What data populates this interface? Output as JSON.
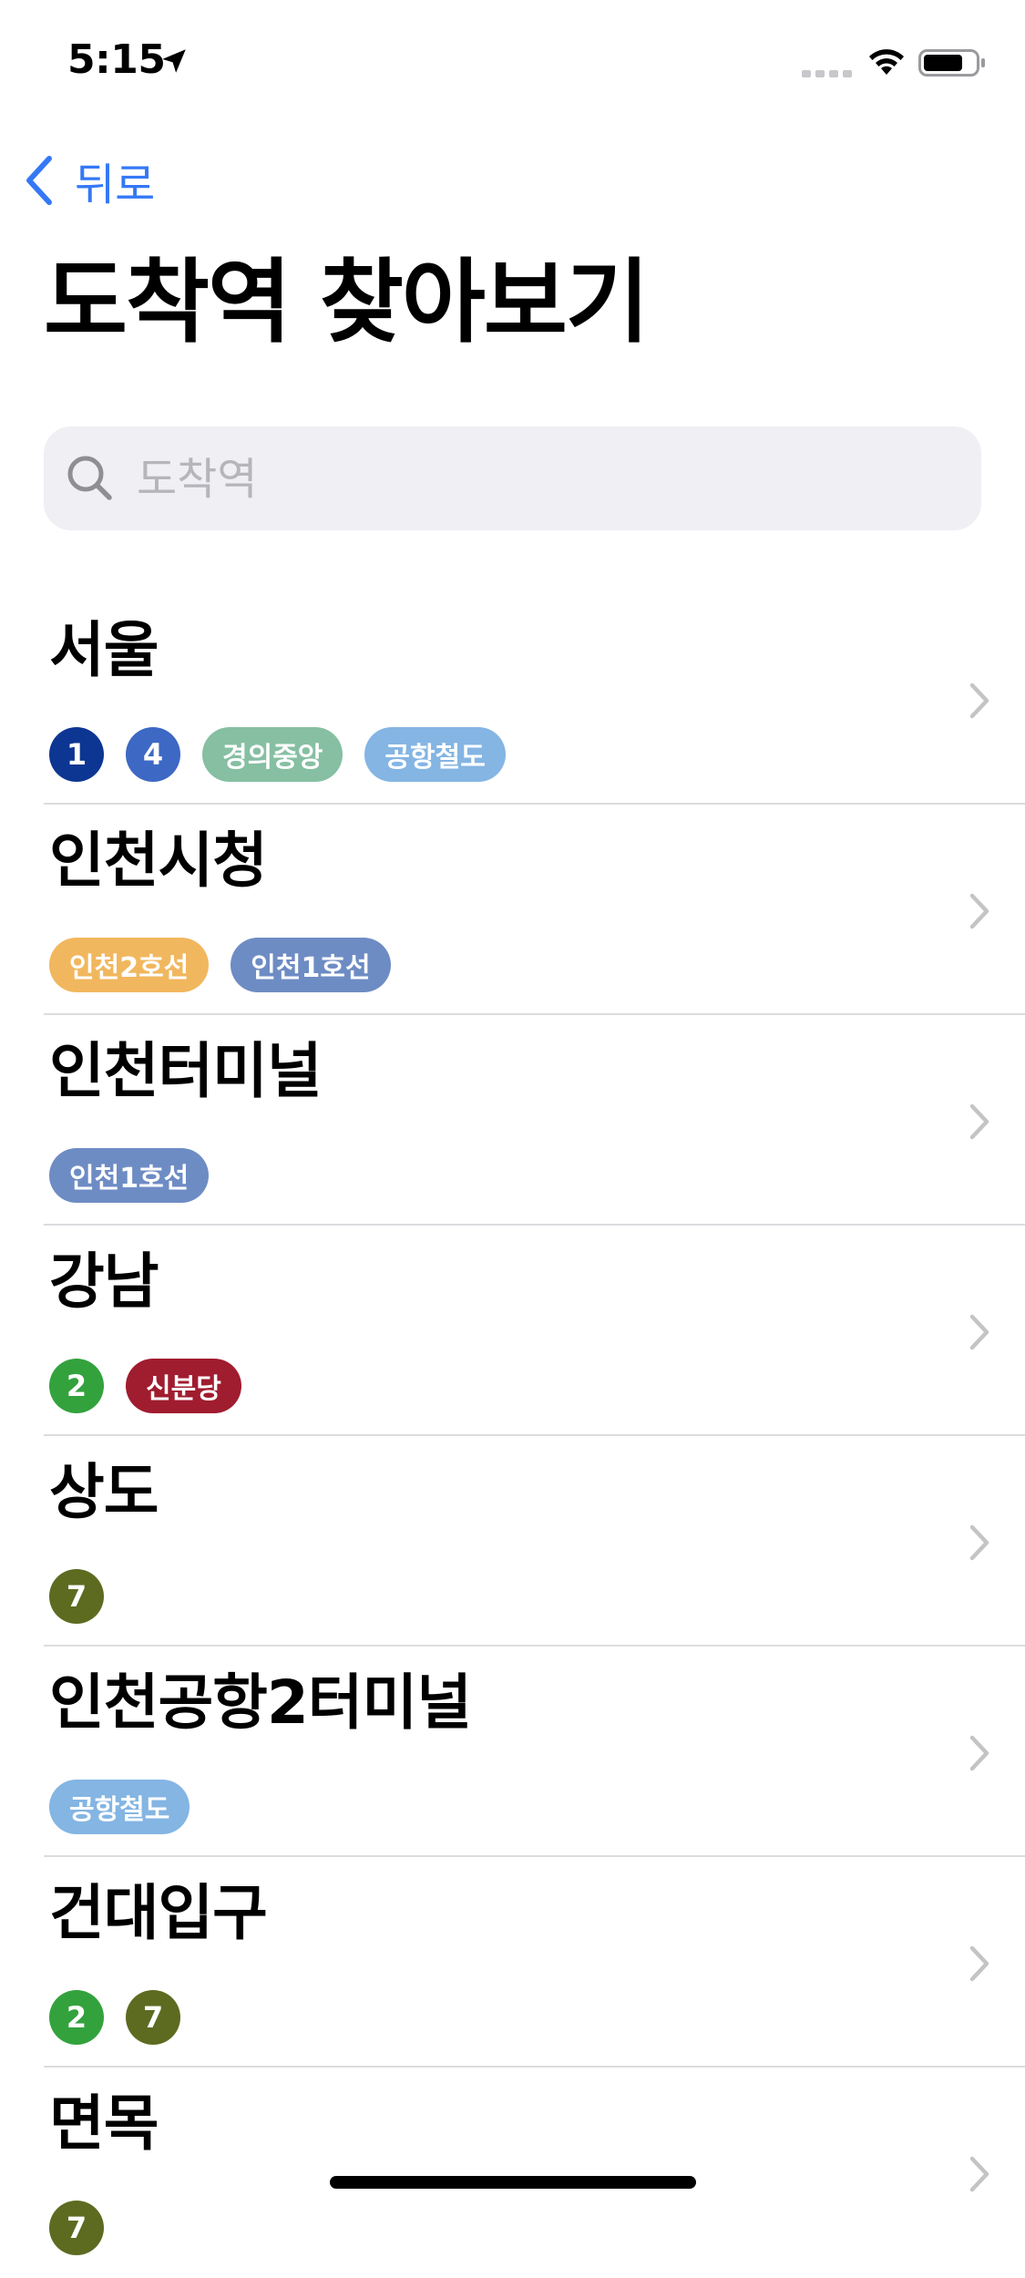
{
  "status_bar": {
    "time": "5:15"
  },
  "nav": {
    "back_label": "뒤로"
  },
  "page": {
    "title": "도착역 찾아보기"
  },
  "search": {
    "placeholder": "도착역",
    "value": ""
  },
  "colors": {
    "accent": "#3478f6",
    "line_1": "#0d3692",
    "line_2": "#33a23d",
    "line_4": "#3d68c4",
    "line_7": "#5d6b21",
    "gyeongui_jungang": "#86bfa2",
    "airport_railroad": "#84b5e3",
    "incheon_1": "#6e8cc4",
    "incheon_2": "#f1b75e",
    "shinbundang": "#a01c2f"
  },
  "stations": [
    {
      "name": "서울",
      "lines": [
        {
          "label": "1",
          "shape": "circle",
          "color": "#0d3692"
        },
        {
          "label": "4",
          "shape": "circle",
          "color": "#3d68c4"
        },
        {
          "label": "경의중앙",
          "shape": "pill",
          "color": "#86bfa2"
        },
        {
          "label": "공항철도",
          "shape": "pill",
          "color": "#84b5e3"
        }
      ]
    },
    {
      "name": "인천시청",
      "lines": [
        {
          "label": "인천2호선",
          "shape": "pill",
          "color": "#f1b75e"
        },
        {
          "label": "인천1호선",
          "shape": "pill",
          "color": "#6e8cc4"
        }
      ]
    },
    {
      "name": "인천터미널",
      "lines": [
        {
          "label": "인천1호선",
          "shape": "pill",
          "color": "#6e8cc4"
        }
      ]
    },
    {
      "name": "강남",
      "lines": [
        {
          "label": "2",
          "shape": "circle",
          "color": "#33a23d"
        },
        {
          "label": "신분당",
          "shape": "pill",
          "color": "#a01c2f"
        }
      ]
    },
    {
      "name": "상도",
      "lines": [
        {
          "label": "7",
          "shape": "circle",
          "color": "#5d6b21"
        }
      ]
    },
    {
      "name": "인천공항2터미널",
      "lines": [
        {
          "label": "공항철도",
          "shape": "pill",
          "color": "#84b5e3"
        }
      ]
    },
    {
      "name": "건대입구",
      "lines": [
        {
          "label": "2",
          "shape": "circle",
          "color": "#33a23d"
        },
        {
          "label": "7",
          "shape": "circle",
          "color": "#5d6b21"
        }
      ]
    },
    {
      "name": "면목",
      "lines": [
        {
          "label": "7",
          "shape": "circle",
          "color": "#5d6b21"
        }
      ]
    }
  ]
}
